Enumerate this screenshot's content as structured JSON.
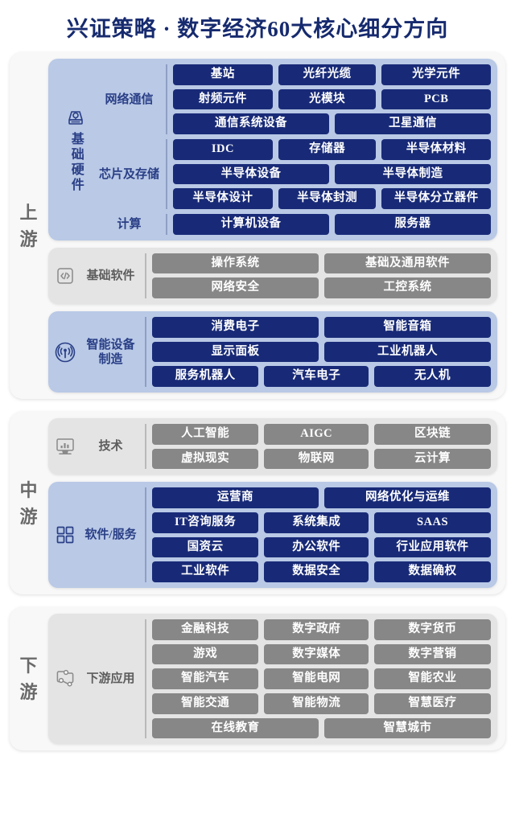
{
  "title": "兴证策略 · 数字经济60大核心细分方向",
  "colors": {
    "title": "#162a6e",
    "chip_blue": "#182a77",
    "chip_gray": "#878787",
    "panel_blue": "#b9c9e6",
    "panel_gray": "#e4e4e4",
    "card_bg": "#f8f8f8",
    "tier_label": "#6a6a6a"
  },
  "tiers": [
    {
      "label_chars": [
        "上",
        "游"
      ],
      "groups": [
        {
          "style": "blue",
          "superlabel": "基础硬件",
          "icon": "server-hardware-icon",
          "subgroups": [
            {
              "name": "网络通信",
              "rows": [
                {
                  "cols": 3,
                  "chips": [
                    "基站",
                    "光纤光缆",
                    "光学元件"
                  ]
                },
                {
                  "cols": 3,
                  "chips": [
                    "射频元件",
                    "光模块",
                    "PCB"
                  ]
                },
                {
                  "cols": 2,
                  "chips": [
                    "通信系统设备",
                    "卫星通信"
                  ]
                }
              ]
            },
            {
              "name": "芯片及存储",
              "rows": [
                {
                  "cols": 3,
                  "chips": [
                    "IDC",
                    "存储器",
                    "半导体材料"
                  ]
                },
                {
                  "cols": 2,
                  "chips": [
                    "半导体设备",
                    "半导体制造"
                  ]
                },
                {
                  "cols": 3,
                  "chips": [
                    "半导体设计",
                    "半导体封测",
                    "半导体分立器件"
                  ]
                }
              ]
            },
            {
              "name": "计算",
              "rows": [
                {
                  "cols": 2,
                  "chips": [
                    "计算机设备",
                    "服务器"
                  ]
                }
              ]
            }
          ]
        },
        {
          "style": "gray",
          "superlabel": null,
          "icon": "code-icon",
          "subgroups": [
            {
              "name": "基础软件",
              "rows": [
                {
                  "cols": 2,
                  "chips": [
                    "操作系统",
                    "基础及通用软件"
                  ]
                },
                {
                  "cols": 2,
                  "chips": [
                    "网络安全",
                    "工控系统"
                  ]
                }
              ]
            }
          ]
        },
        {
          "style": "blue",
          "superlabel": null,
          "icon": "signal-broadcast-icon",
          "subgroups": [
            {
              "name": "智能设备制造",
              "rows": [
                {
                  "cols": 2,
                  "chips": [
                    "消费电子",
                    "智能音箱"
                  ]
                },
                {
                  "cols": 2,
                  "chips": [
                    "显示面板",
                    "工业机器人"
                  ]
                },
                {
                  "cols": 3,
                  "chips": [
                    "服务机器人",
                    "汽车电子",
                    "无人机"
                  ]
                }
              ]
            }
          ]
        }
      ]
    },
    {
      "label_chars": [
        "中",
        "游"
      ],
      "groups": [
        {
          "style": "gray",
          "superlabel": null,
          "icon": "monitor-chart-icon",
          "subgroups": [
            {
              "name": "技术",
              "rows": [
                {
                  "cols": 3,
                  "chips": [
                    "人工智能",
                    "AIGC",
                    "区块链"
                  ]
                },
                {
                  "cols": 3,
                  "chips": [
                    "虚拟现实",
                    "物联网",
                    "云计算"
                  ]
                }
              ]
            }
          ]
        },
        {
          "style": "blue",
          "superlabel": null,
          "icon": "grid-squares-icon",
          "subgroups": [
            {
              "name": "软件/服务",
              "rows": [
                {
                  "cols": 2,
                  "chips": [
                    "运营商",
                    "网络优化与运维"
                  ]
                },
                {
                  "cols": 3,
                  "chips": [
                    "IT咨询服务",
                    "系统集成",
                    "SAAS"
                  ]
                },
                {
                  "cols": 3,
                  "chips": [
                    "国资云",
                    "办公软件",
                    "行业应用软件"
                  ]
                },
                {
                  "cols": 3,
                  "chips": [
                    "工业软件",
                    "数据安全",
                    "数据确权"
                  ]
                }
              ]
            }
          ]
        }
      ]
    },
    {
      "label_chars": [
        "下",
        "游"
      ],
      "groups": [
        {
          "style": "gray",
          "superlabel": null,
          "icon": "network-nodes-icon",
          "subgroups": [
            {
              "name": "下游应用",
              "rows": [
                {
                  "cols": 3,
                  "chips": [
                    "金融科技",
                    "数字政府",
                    "数字货币"
                  ]
                },
                {
                  "cols": 3,
                  "chips": [
                    "游戏",
                    "数字媒体",
                    "数字营销"
                  ]
                },
                {
                  "cols": 3,
                  "chips": [
                    "智能汽车",
                    "智能电网",
                    "智能农业"
                  ]
                },
                {
                  "cols": 3,
                  "chips": [
                    "智能交通",
                    "智能物流",
                    "智慧医疗"
                  ]
                },
                {
                  "cols": 2,
                  "chips": [
                    "在线教育",
                    "智慧城市"
                  ]
                }
              ]
            }
          ]
        }
      ]
    }
  ]
}
